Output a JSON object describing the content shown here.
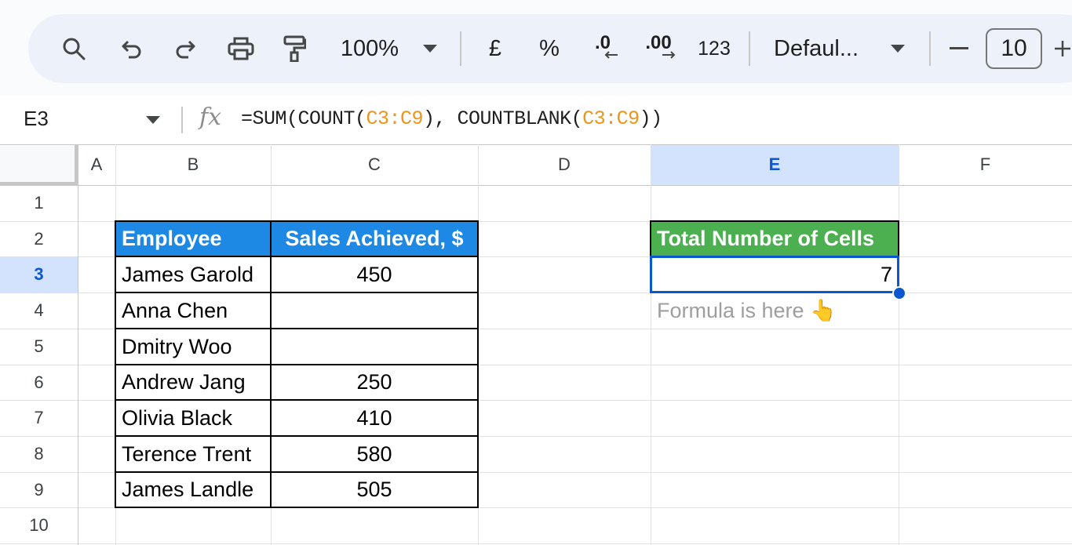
{
  "toolbar": {
    "zoom": "100%",
    "currency_symbol": "£",
    "percent_symbol": "%",
    "decrease_decimal_label": ".0",
    "increase_decimal_label": ".00",
    "number_format_label": "123",
    "font_name": "Defaul...",
    "font_size": "10",
    "minus": "−",
    "plus": "+",
    "icons": [
      "search-icon",
      "undo-icon",
      "redo-icon",
      "print-icon",
      "paint-format-icon",
      "chevron-down-icon",
      "minus-icon",
      "plus-icon"
    ]
  },
  "formula_bar": {
    "name_box": "E3",
    "fx_label": "fx",
    "formula_parts": {
      "p1": "=SUM(COUNT(",
      "r1": "C3:C9",
      "p2": "), COUNTBLANK(",
      "r2": "C3:C9",
      "p3": "))"
    }
  },
  "columns": [
    "A",
    "B",
    "C",
    "D",
    "E",
    "F"
  ],
  "rows": [
    "1",
    "2",
    "3",
    "4",
    "5",
    "6",
    "7",
    "8",
    "9",
    "10"
  ],
  "selected": {
    "column": "E",
    "row": "3"
  },
  "table": {
    "headers": {
      "employee": "Employee",
      "sales": "Sales Achieved, $"
    },
    "rows": [
      {
        "employee": "James Garold",
        "sales": "450"
      },
      {
        "employee": "Anna Chen",
        "sales": ""
      },
      {
        "employee": "Dmitry Woo",
        "sales": ""
      },
      {
        "employee": "Andrew Jang",
        "sales": "250"
      },
      {
        "employee": "Olivia Black",
        "sales": "410"
      },
      {
        "employee": "Terence Trent",
        "sales": "580"
      },
      {
        "employee": "James Landle",
        "sales": "505"
      }
    ]
  },
  "result": {
    "header": "Total Number of Cells",
    "value": "7",
    "note": "Formula is here 👆"
  },
  "colors": {
    "table_header": "#1e88e5",
    "result_header": "#4caf50",
    "formula_ref": "#e8961e",
    "selection": "#0b57d0"
  }
}
